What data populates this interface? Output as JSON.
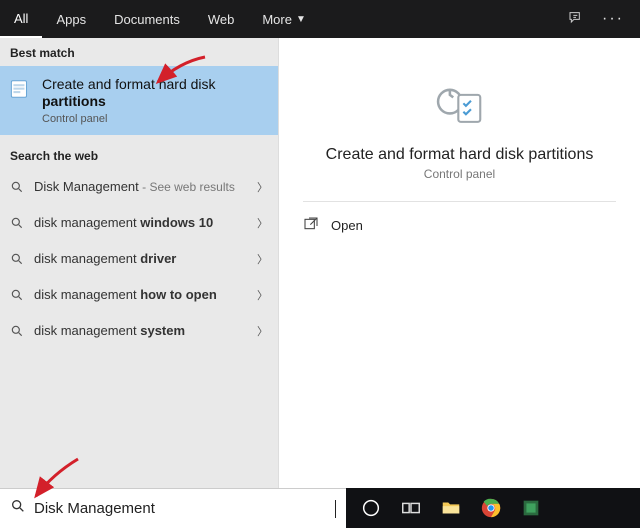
{
  "header": {
    "tabs": [
      "All",
      "Apps",
      "Documents",
      "Web",
      "More"
    ]
  },
  "left": {
    "best_match_label": "Best match",
    "best_match": {
      "line1": "Create and format hard disk",
      "line2": "partitions",
      "sub": "Control panel"
    },
    "web_label": "Search the web",
    "web_items": [
      {
        "prefix": "Disk Management",
        "bold": "",
        "suffix": " - See web results",
        "has_sub": true
      },
      {
        "prefix": "disk management ",
        "bold": "windows 10",
        "suffix": ""
      },
      {
        "prefix": "disk management ",
        "bold": "driver",
        "suffix": ""
      },
      {
        "prefix": "disk management ",
        "bold": "how to open",
        "suffix": ""
      },
      {
        "prefix": "disk management ",
        "bold": "system",
        "suffix": ""
      }
    ]
  },
  "right": {
    "title": "Create and format hard disk partitions",
    "sub": "Control panel",
    "open_label": "Open"
  },
  "search": {
    "value": "Disk Management"
  }
}
